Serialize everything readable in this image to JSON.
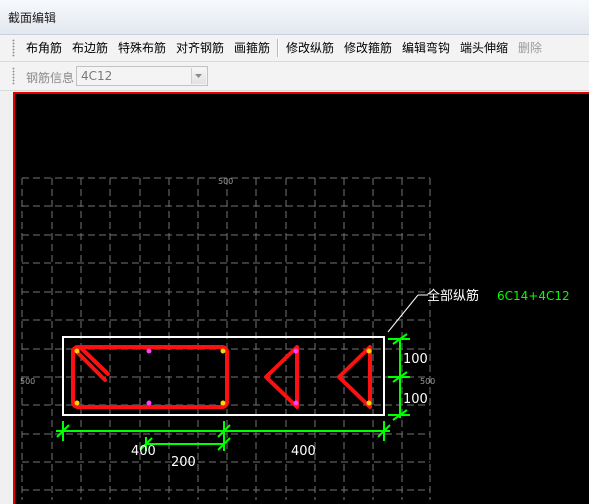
{
  "window": {
    "title": "截面编辑"
  },
  "toolbar": {
    "buttons": [
      {
        "label": "布角筋",
        "enabled": true
      },
      {
        "label": "布边筋",
        "enabled": true
      },
      {
        "label": "特殊布筋",
        "enabled": true
      },
      {
        "label": "对齐钢筋",
        "enabled": true
      },
      {
        "label": "画箍筋",
        "enabled": true
      },
      {
        "label": "修改纵筋",
        "enabled": true
      },
      {
        "label": "修改箍筋",
        "enabled": true
      },
      {
        "label": "编辑弯钩",
        "enabled": true
      },
      {
        "label": "端头伸缩",
        "enabled": true
      },
      {
        "label": "删除",
        "enabled": false
      }
    ]
  },
  "rebar_info": {
    "label": "钢筋信息",
    "value": "4C12"
  },
  "drawing": {
    "grid_labels": {
      "top": "500",
      "left": "500",
      "right": "500"
    },
    "annotation_label": "全部纵筋",
    "annotation_value": "6C14+4C12",
    "dimensions": {
      "right_upper": "100",
      "right_lower": "100",
      "bottom_left": "400",
      "bottom_inner": "200",
      "bottom_right": "400"
    },
    "colors": {
      "background": "#000000",
      "outline": "#ffffff",
      "stirrup": "#ff1010",
      "dimension": "#00ff00",
      "annotation_value": "#00ff00",
      "corner_bar": "#ffd200",
      "edge_bar": "#ff40ff",
      "grid": "#9a9a9a"
    }
  }
}
